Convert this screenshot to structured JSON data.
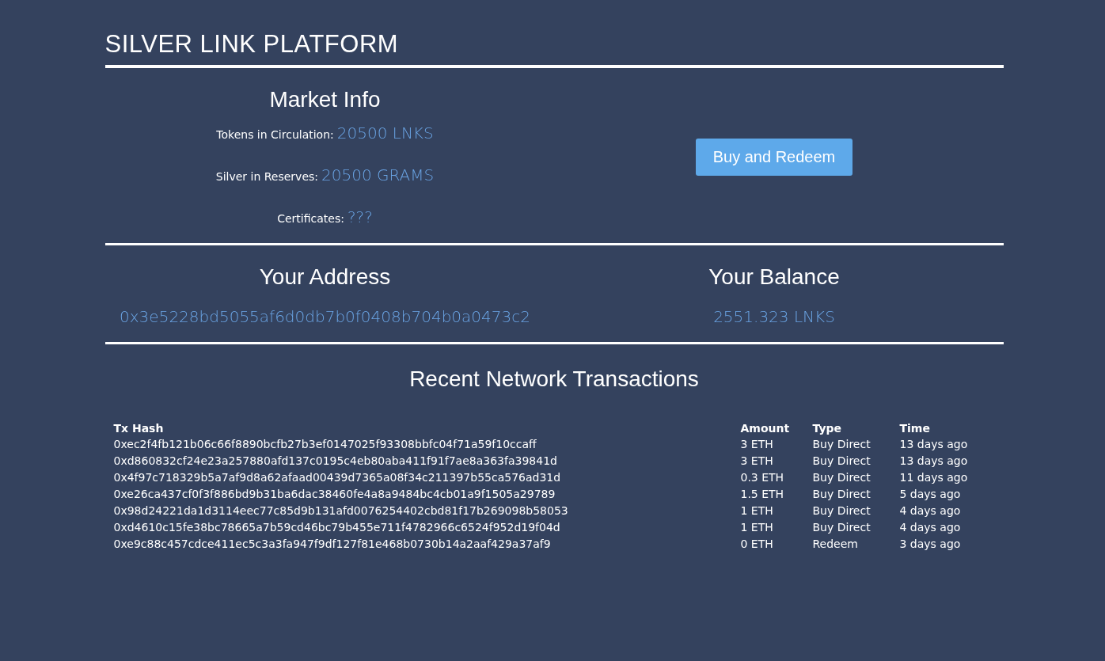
{
  "header": {
    "title": "SILVER LINK PLATFORM"
  },
  "market_info": {
    "heading": "Market Info",
    "stats": [
      {
        "label": "Tokens in Circulation:",
        "value": "20500 LNKS"
      },
      {
        "label": "Silver in Reserves:",
        "value": "20500 GRAMS"
      },
      {
        "label": "Certificates:",
        "value": "???"
      }
    ],
    "button": "Buy and Redeem"
  },
  "account": {
    "address_heading": "Your Address",
    "address": "0x3e5228bd5055af6d0db7b0f0408b704b0a0473c2",
    "balance_heading": "Your Balance",
    "balance": "2551.323 LNKS"
  },
  "transactions": {
    "heading": "Recent Network Transactions",
    "columns": [
      "Tx Hash",
      "Amount",
      "Type",
      "Time"
    ],
    "rows": [
      [
        "0xec2f4fb121b06c66f8890bcfb27b3ef0147025f93308bbfc04f71a59f10ccaff",
        "3 ETH",
        "Buy Direct",
        "13 days ago"
      ],
      [
        "0xd860832cf24e23a257880afd137c0195c4eb80aba411f91f7ae8a363fa39841d",
        "3 ETH",
        "Buy Direct",
        "13 days ago"
      ],
      [
        "0x4f97c718329b5a7af9d8a62afaad00439d7365a08f34c211397b55ca576ad31d",
        "0.3 ETH",
        "Buy Direct",
        "11 days ago"
      ],
      [
        "0xe26ca437cf0f3f886bd9b31ba6dac38460fe4a8a9484bc4cb01a9f1505a29789",
        "1.5 ETH",
        "Buy Direct",
        "5 days ago"
      ],
      [
        "0x98d24221da1d3114eec77c85d9b131afd0076254402cbd81f17b269098b58053",
        "1 ETH",
        "Buy Direct",
        "4 days ago"
      ],
      [
        "0xd4610c15fe38bc78665a7b59cd46bc79b455e711f4782966c6524f952d19f04d",
        "1 ETH",
        "Buy Direct",
        "4 days ago"
      ],
      [
        "0xe9c88c457cdce411ec5c3a3fa947f9df127f81e468b0730b14a2aaf429a37af9",
        "0 ETH",
        "Redeem",
        "3 days ago"
      ]
    ]
  }
}
